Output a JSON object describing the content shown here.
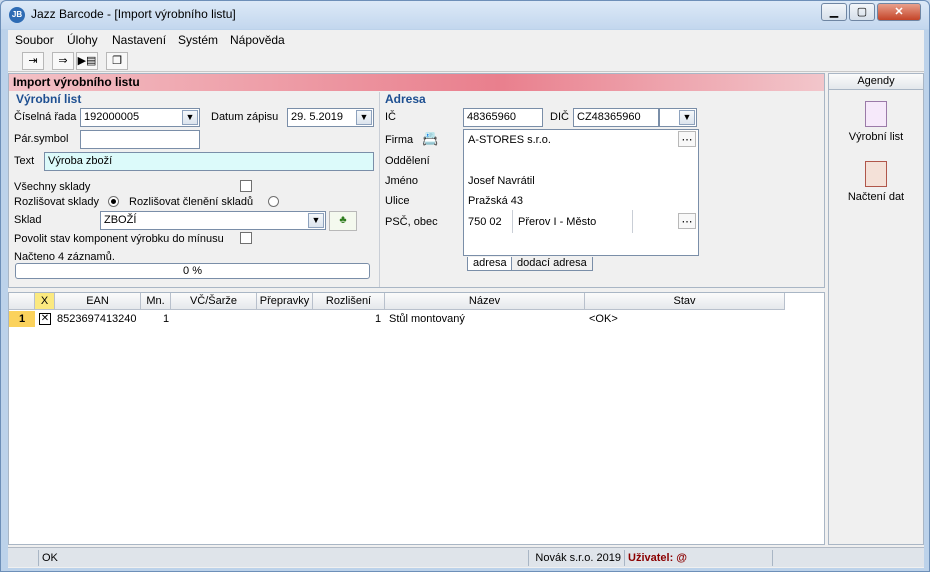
{
  "window": {
    "title": "Jazz Barcode - [Import výrobního listu]",
    "app_icon": "jazz-icon"
  },
  "menu": [
    "Soubor",
    "Úlohy",
    "Nastavení",
    "Systém",
    "Nápověda"
  ],
  "toolbar": {
    "icons": [
      "exit-icon",
      "transfer-icon",
      "copy-icon"
    ]
  },
  "form": {
    "title": "Import výrobního listu",
    "vyrobni": {
      "section": "Výrobní list",
      "ciselna_rada_label": "Číselná řada",
      "ciselna_rada_value": "192000005",
      "datum_label": "Datum zápisu",
      "datum_value": "29. 5.2019",
      "par_symbol_label": "Pár.symbol",
      "par_symbol_value": "",
      "text_label": "Text",
      "text_value": "Výroba zboží",
      "vsechny_sklady": "Všechny sklady",
      "rozlisovat_sklady": "Rozlišovat sklady",
      "rozlisovat_cleneni": "Rozlišovat členění skladů",
      "sklad_label": "Sklad",
      "sklad_value": "ZBOŽÍ",
      "povolit": "Povolit stav komponent výrobku do mínusu",
      "status_text": "Načteno 4 záznamů.",
      "progress_text": "0 %",
      "progress": 0
    },
    "adresa": {
      "section": "Adresa",
      "ic_label": "IČ",
      "ic_value": "48365960",
      "dic_label": "DIČ",
      "dic_value": "CZ48365960",
      "firma_label": "Firma",
      "firma_value": "A-STORES s.r.o.",
      "oddeleni_label": "Oddělení",
      "jmeno_label": "Jméno",
      "jmeno_value": "Josef Navrátil",
      "ulice_label": "Ulice",
      "ulice_value": "Pražská 43",
      "psc_label": "PSČ, obec",
      "psc_value": "750 02",
      "obec_value": "Přerov I - Město",
      "tabs": [
        "adresa",
        "dodací adresa"
      ]
    }
  },
  "grid": {
    "columns": [
      "",
      "X",
      "EAN",
      "Mn.",
      "VČ/Šarže",
      "Přepravky",
      "Rozlišení",
      "Název",
      "Stav"
    ],
    "rows": [
      {
        "num": "1",
        "checked": "✕",
        "ean": "8523697413240",
        "mn": "1",
        "vc": "",
        "prepravky": "",
        "rozliseni": "1",
        "nazev": "Stůl montovaný",
        "stav": "<OK>"
      }
    ]
  },
  "agendy": {
    "title": "Agendy",
    "items": [
      {
        "label": "Výrobní list",
        "icon": "document-list-icon"
      },
      {
        "label": "Načtení dat",
        "icon": "calculator-icon"
      }
    ]
  },
  "statusbar": {
    "left": "OK",
    "company": "Novák s.r.o. 2019",
    "user": "Uživatel: @"
  },
  "colors": {
    "header_gradient": "#e97f8d",
    "section_title": "#1d4f91",
    "user_text": "#8b0000"
  }
}
